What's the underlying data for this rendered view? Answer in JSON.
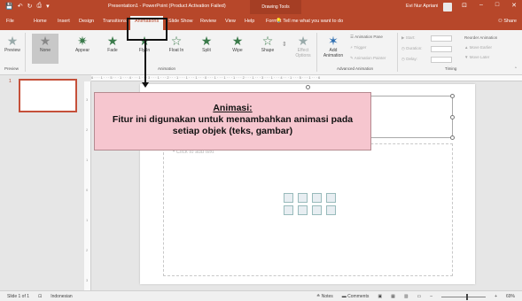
{
  "titlebar": {
    "quick_access": [
      "💾",
      "↶",
      "↻",
      "⎙",
      "▾"
    ],
    "title": "Presentation1 - PowerPoint (Product Activation Failed)",
    "context": "Drawing Tools",
    "user": "Evi Nur Apriani",
    "window_buttons": [
      "⊡",
      "–",
      "□",
      "✕"
    ]
  },
  "tabs": [
    "File",
    "Home",
    "Insert",
    "Design",
    "Transitions",
    "Animations",
    "Slide Show",
    "Review",
    "View",
    "Help",
    "Format"
  ],
  "active_tab": "Animations",
  "tell_me": "Tell me what you want to do",
  "share": "Share",
  "ribbon": {
    "preview": "Preview",
    "preview_group": "Preview",
    "animations": [
      "None",
      "Appear",
      "Fade",
      "Fly In",
      "Float In",
      "Split",
      "Wipe",
      "Shape"
    ],
    "effect_options": "Effect Options",
    "animation_group": "Animation",
    "add_animation": "Add Animation",
    "animation_pane": "Animation Pane",
    "trigger": "Trigger",
    "animation_painter": "Animation Painter",
    "advanced_group": "Advanced Animation",
    "start": "Start:",
    "duration": "Duration:",
    "delay": "Delay:",
    "timing_group": "Timing",
    "reorder": "Reorder Animation",
    "move_earlier": "Move Earlier",
    "move_later": "Move Later"
  },
  "slide_number": "1",
  "ruler_text": "6 · · · 1 · · · 5 · · · 1 · · · 4 · · · 1 · · · 3 · · · 1 · · · 2 · · · 1 · · · 1 · · · 1 · · · 0 · · · 1 · · · 1 · · · 1 · · · 2 · · · 1 · · · 3 · · · 1 · · · 4 · · · 1 · · · 5 · · · 1 · · · 6",
  "vruler_marks": [
    "3",
    "2",
    "1",
    "0",
    "1",
    "2",
    "3"
  ],
  "slide": {
    "content_hint": "• Click to add text"
  },
  "callout": {
    "heading": "Animasi:",
    "body": "Fitur ini digunakan untuk menambahkan animasi pada setiap objek (teks, gambar)"
  },
  "status": {
    "slide_info": "Slide 1 of 1",
    "language": "Indonesian",
    "notes": "Notes",
    "comments": "Comments",
    "zoom": "69%"
  }
}
